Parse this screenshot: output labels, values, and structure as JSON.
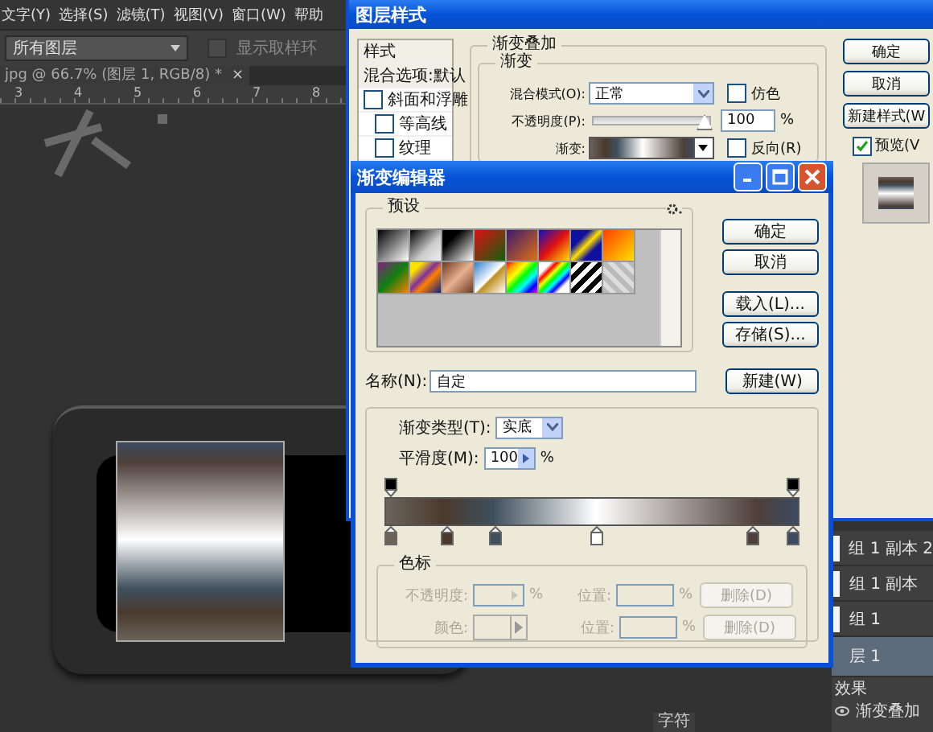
{
  "menu_bar": [
    "文字(Y)",
    "选择(S)",
    "滤镜(T)",
    "视图(V)",
    "窗口(W)",
    "帮助"
  ],
  "options_bar": {
    "sample_dropdown": "所有图层",
    "show_ring": {
      "label": "显示取样环",
      "checked": false
    }
  },
  "document_tab": {
    "title": "jpg @ 66.7% (图层 1, RGB/8) *",
    "close": "×"
  },
  "ruler": [
    "3",
    "4",
    "5",
    "6",
    "7",
    "8"
  ],
  "layers_panel": {
    "rows": [
      {
        "name": "组 1 副本 2",
        "selected": false
      },
      {
        "name": "组 1 副本",
        "selected": false
      },
      {
        "name": "组 1",
        "selected": false
      },
      {
        "name": "层 1",
        "selected": true
      }
    ],
    "effects_label": "效果",
    "effects": [
      {
        "name": "渐变叠加",
        "visible": true
      }
    ]
  },
  "panel_tab": "字符",
  "layer_style": {
    "title": "图层样式",
    "styles": [
      {
        "label": "样式",
        "kind": "header"
      },
      {
        "label": "混合选项:默认",
        "kind": "header"
      },
      {
        "label": "斜面和浮雕",
        "kind": "check",
        "checked": false
      },
      {
        "label": "等高线",
        "kind": "subcheck",
        "checked": false
      },
      {
        "label": "纹理",
        "kind": "subcheck",
        "checked": false
      }
    ],
    "section": "渐变叠加",
    "group": "渐变",
    "blend_mode": {
      "label": "混合模式(O):",
      "value": "正常"
    },
    "dither": {
      "label": "仿色",
      "checked": false
    },
    "opacity": {
      "label": "不透明度(P):",
      "level": 1,
      "value": "100",
      "unit": "%"
    },
    "gradient": {
      "label": "渐变:"
    },
    "reverse": {
      "label": "反向(R)",
      "checked": false
    },
    "buttons": [
      "确定",
      "取消",
      "新建样式(W"
    ],
    "preview": {
      "label": "预览(V",
      "checked": true
    }
  },
  "gradient_editor": {
    "title": "渐变编辑器",
    "presets_label": "预设",
    "buttons": [
      "确定",
      "取消",
      "载入(L)...",
      "存储(S)..."
    ],
    "name": {
      "label": "名称(N):",
      "value": "自定"
    },
    "new_button": "新建(W)",
    "type": {
      "label": "渐变类型(T):",
      "value": "实底"
    },
    "smoothness": {
      "label": "平滑度(M):",
      "value": "100",
      "unit": "%"
    },
    "opacity_stops": [
      {
        "level": 0
      },
      {
        "level": 1
      }
    ],
    "color_stops": [
      {
        "level": 0,
        "color": "#6b635a"
      },
      {
        "level": 0.14,
        "color": "#4a3a2e"
      },
      {
        "level": 0.26,
        "color": "#3f4f5c"
      },
      {
        "level": 0.51,
        "color": "#ffffff"
      },
      {
        "level": 0.9,
        "color": "#4e3f3a"
      },
      {
        "level": 1,
        "color": "#3c4a5e"
      }
    ],
    "stops_group": {
      "label": "色标",
      "disabled": true,
      "rows": [
        {
          "kind": "opacity",
          "label": "不透明度:",
          "unit": "%",
          "location_label": "位置:",
          "location_unit": "%",
          "delete": "删除(D)"
        },
        {
          "kind": "color",
          "label": "颜色:",
          "location_label": "位置:",
          "location_unit": "%",
          "delete": "删除(D)"
        }
      ]
    }
  }
}
